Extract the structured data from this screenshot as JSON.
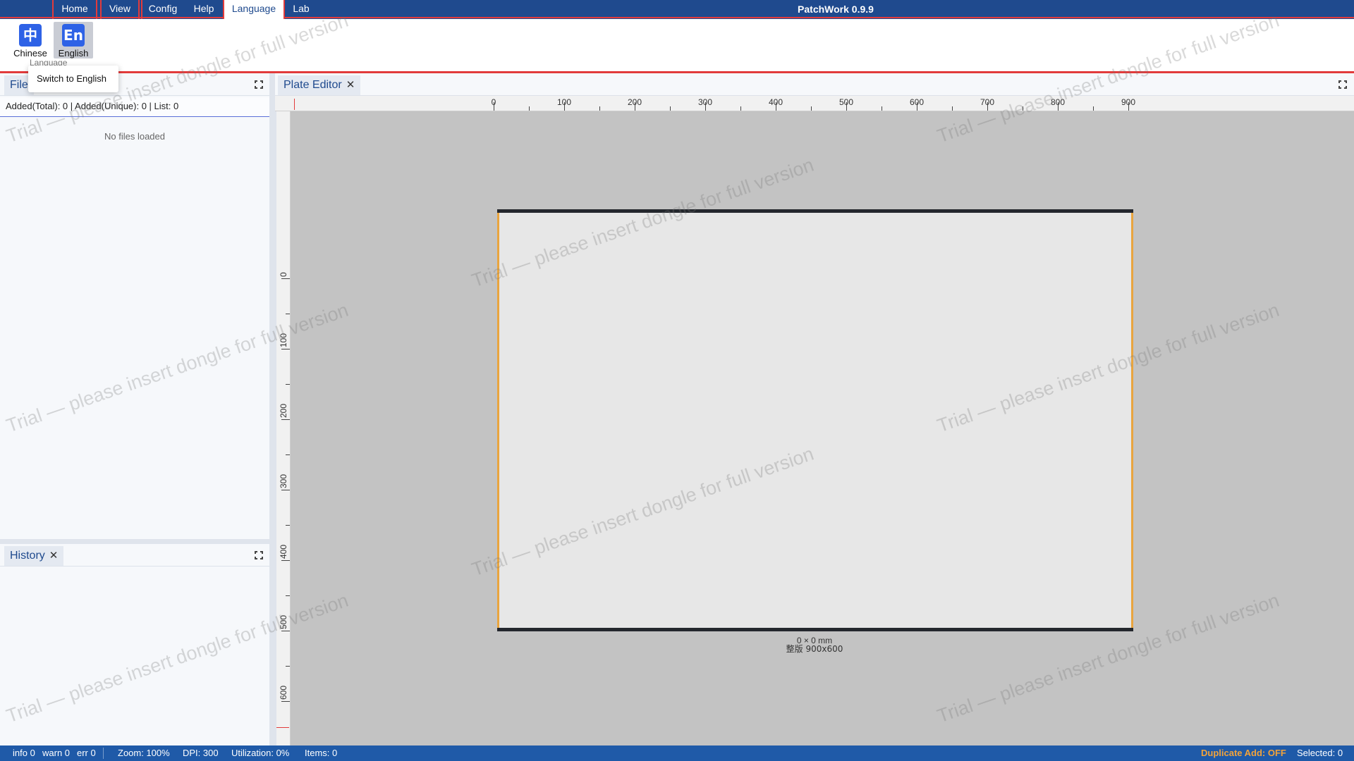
{
  "app": {
    "title": "PatchWork 0.9.9"
  },
  "menu": [
    {
      "label": "Home"
    },
    {
      "label": "View"
    },
    {
      "label": "Config"
    },
    {
      "label": "Help"
    },
    {
      "label": "Language"
    },
    {
      "label": "Lab"
    }
  ],
  "ribbon": {
    "buttons": [
      {
        "icon_text": "中",
        "label": "Chinese"
      },
      {
        "icon_text": "En",
        "label": "English"
      }
    ],
    "group_label": "Language",
    "tooltip": "Switch to English"
  },
  "files_panel": {
    "tab_label": "File",
    "counts": "Added(Total): 0 | Added(Unique): 0 | List: 0",
    "empty": "No files loaded"
  },
  "history_panel": {
    "tab_label": "History"
  },
  "editor": {
    "tab_label": "Plate Editor",
    "ruler_x": [
      "0",
      "100",
      "200",
      "300",
      "400",
      "500",
      "600",
      "700",
      "800",
      "900"
    ],
    "ruler_y": [
      "0",
      "100",
      "200",
      "300",
      "400",
      "500",
      "600"
    ],
    "plate_dim": "0 × 0 mm",
    "plate_name": "整版  900x600"
  },
  "watermark": "Trial — please insert dongle for full version",
  "status": {
    "info": "info 0",
    "warn": "warn 0",
    "err": "err 0",
    "zoom": "Zoom: 100%",
    "dpi": "DPI: 300",
    "utilization": "Utilization: 0%",
    "items": "Items: 0",
    "duplicate": "Duplicate Add: OFF",
    "selected": "Selected: 0"
  },
  "colors": {
    "menubar": "#1f4a8e",
    "accent_red": "#e23b3b",
    "plate_edge": "#e9a53f",
    "statusbar": "#1f5aa8"
  }
}
